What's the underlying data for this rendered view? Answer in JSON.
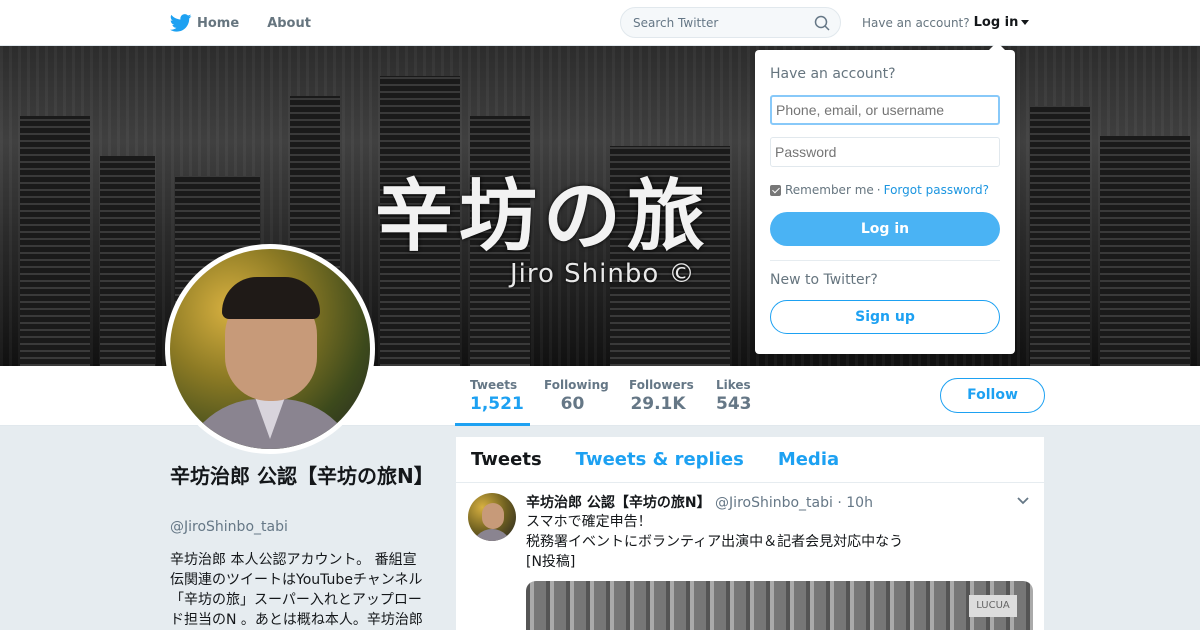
{
  "nav": {
    "home_label": "Home",
    "about_label": "About",
    "search_placeholder": "Search Twitter",
    "have_account": "Have an account?",
    "login_label": "Log in"
  },
  "banner": {
    "title_text": "辛坊の旅",
    "subtitle_text": "Jiro Shinbo ©"
  },
  "stats": [
    {
      "label": "Tweets",
      "value": "1,521",
      "active": true
    },
    {
      "label": "Following",
      "value": "60",
      "active": false
    },
    {
      "label": "Followers",
      "value": "29.1K",
      "active": false
    },
    {
      "label": "Likes",
      "value": "543",
      "active": false
    }
  ],
  "follow_label": "Follow",
  "profile": {
    "name": "辛坊治郎 公認【辛坊の旅N】",
    "handle": "@JiroShinbo_tabi",
    "bio": "辛坊治郎 本人公認アカウント。 番組宣伝関連のツイートはYouTubeチャンネル「辛坊の旅」スーパー入れとアップロード担当のN 。あとは概ね本人。辛坊治郎"
  },
  "timeline": {
    "tabs": [
      "Tweets",
      "Tweets & replies",
      "Media"
    ],
    "tweet": {
      "name": "辛坊治郎 公認【辛坊の旅N】",
      "handle": "@JiroShinbo_tabi",
      "dot": "·",
      "time": "10h",
      "lines": [
        "スマホで確定申告！",
        "税務署イベントにボランティア出演中＆記者会見対応中なう",
        "[N投稿]"
      ],
      "media_sign": "LUCUA"
    }
  },
  "login_dropdown": {
    "title": "Have an account?",
    "username_placeholder": "Phone, email, or username",
    "password_placeholder": "Password",
    "remember_label": "Remember me",
    "separator": "·",
    "forgot_label": "Forgot password?",
    "login_button": "Log in",
    "new_label": "New to Twitter?",
    "signup_button": "Sign up"
  },
  "colors": {
    "accent": "#1da1f2",
    "login_button_bg": "#4ab3f4",
    "page_bg": "#e6ecf0"
  }
}
